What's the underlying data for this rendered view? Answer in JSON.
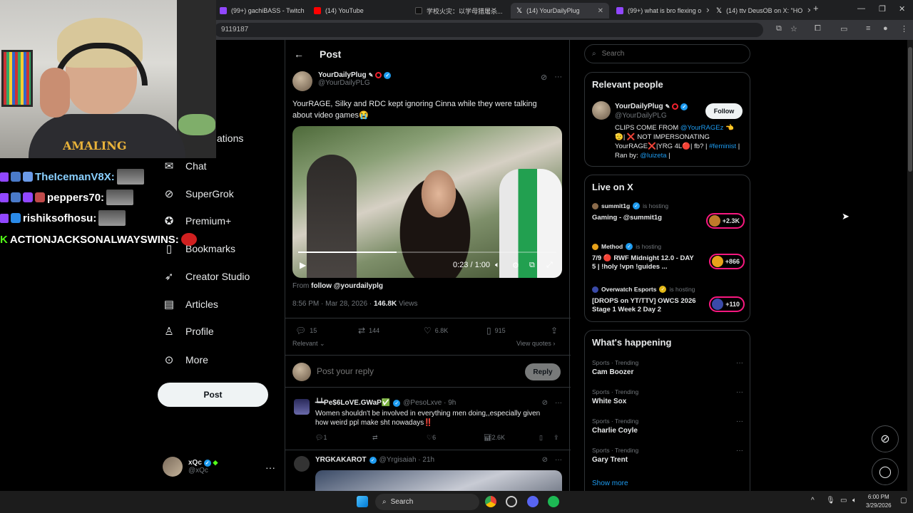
{
  "browser": {
    "tabs": [
      {
        "title": "(99+) gachiBASS - Twitch",
        "color": "#9147ff"
      },
      {
        "title": "(14) YouTube",
        "color": "#ff0000"
      },
      {
        "title": "学校火灾：以学母猎屠杀...",
        "color": "#ffffff"
      },
      {
        "title": "(14) YourDailyPlug",
        "color": "#ffffff"
      },
      {
        "title": "(99+) what is bro flexing o",
        "color": "#9147ff"
      },
      {
        "title": "(14) ttv DeusOB on X: \"HO",
        "color": "#ffffff"
      }
    ],
    "url_fragment": "9119187"
  },
  "nav": {
    "notifications_partial": "ations",
    "items": [
      "Chat",
      "SuperGrok",
      "Premium+",
      "Bookmarks",
      "Creator Studio",
      "Articles",
      "Profile",
      "More"
    ],
    "post_button": "Post",
    "account": {
      "name": "xQc",
      "handle": "@xQc"
    }
  },
  "post": {
    "header": "Post",
    "author": {
      "name": "YourDailyPlug",
      "handle": "@YourDailyPLG"
    },
    "text": "YourRAGE, Silky and RDC kept ignoring Cinna while they were talking about video games😭",
    "video": {
      "time": "0:23 / 1:00",
      "progress": 0.38
    },
    "from_label": "From",
    "from_link": "follow @yourdailyplg",
    "timestamp": "8:56 PM · Mar 28, 2026 · ",
    "views_count": "146.8K",
    "views_label": " Views",
    "stats": {
      "replies": "15",
      "reposts": "144",
      "likes": "6.8K",
      "bookmarks": "915"
    },
    "sort_label": "Relevant",
    "view_quotes": "View quotes",
    "reply_placeholder": "Post your reply",
    "reply_button": "Reply"
  },
  "comments": [
    {
      "name": "┶┷Pe$6LoVE.GWaP✅",
      "handle": "@PesoLxve · 9h",
      "text": "Women shouldn't be involved in everything men doing,,especially given how weird ppl make sht nowadays‼️",
      "replies": "1",
      "reposts": "",
      "likes": "6",
      "views": "2.6K"
    },
    {
      "name": "YRGKAKAROT",
      "handle": "@Yrgisaiah · 21h",
      "text": ""
    }
  ],
  "sidebar": {
    "search_placeholder": "Search",
    "relevant_title": "Relevant people",
    "person": {
      "name": "YourDailyPlug",
      "handle": "@YourDailyPLG",
      "follow": "Follow",
      "bio_prefix": "CLIPS COME FROM ",
      "bio_link1": "@YourRAGEz",
      "bio_mid": " 👈 🫡| ❌ NOT IMPERSONATING YourRAGE❌|YRG 4L🔴| fb? | ",
      "bio_link2": "#feminist",
      "bio_mid2": " | Ran by: ",
      "bio_link3": "@luizeta",
      "bio_end": " |"
    },
    "live_title": "Live on X",
    "live": [
      {
        "host": "summit1g",
        "is": "is hosting",
        "title": "Gaming - @summit1g",
        "count": "+2.3K",
        "badge_color": "#c07a2a"
      },
      {
        "host": "Method",
        "is": "is hosting",
        "title": "7/9 🔴 RWF Midnight 12.0 - DAY 5 | !holy !vpn !guides ...",
        "count": "+866",
        "badge_color": "#e8a21a"
      },
      {
        "host": "Overwatch Esports",
        "is": "is hosting",
        "title": "[DROPS on YT/TTV] OWCS 2026 Stage 1 Week 2 Day 2",
        "count": "+110",
        "badge_color": "#3a4aa8"
      }
    ],
    "happening_title": "What's happening",
    "trends": [
      {
        "category": "Sports · Trending",
        "name": "Cam Boozer"
      },
      {
        "category": "Sports · Trending",
        "name": "White Sox"
      },
      {
        "category": "Sports · Trending",
        "name": "Charlie Coyle"
      },
      {
        "category": "Sports · Trending",
        "name": "Gary Trent"
      }
    ],
    "show_more": "Show more"
  },
  "stream_chat": [
    {
      "user": "TheIcemanV8X:"
    },
    {
      "user": "peppers70:"
    },
    {
      "user": "rishiksofhosu:"
    },
    {
      "user": "ACTIONJACKSONALWAYSWINS:"
    }
  ],
  "stream_overlay": {
    "shirt_text": "AMALING"
  },
  "taskbar": {
    "search": "Search",
    "time": "6:00 PM",
    "date": "3/29/2026"
  }
}
